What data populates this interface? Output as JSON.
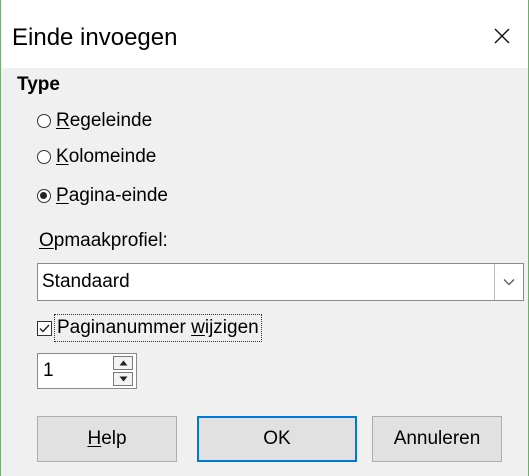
{
  "window": {
    "title": "Einde invoegen"
  },
  "type_section": {
    "title": "Type",
    "options": [
      {
        "key": "R",
        "rest": "egeleinde",
        "checked": false
      },
      {
        "key": "K",
        "rest": "olomeinde",
        "checked": false
      },
      {
        "key": "P",
        "rest": "agina-einde",
        "checked": true
      }
    ]
  },
  "style": {
    "label_key": "O",
    "label_rest": "pmaakprofiel:",
    "value": "Standaard"
  },
  "page_number": {
    "checked": true,
    "label_pre": "Paginanummer ",
    "label_key": "w",
    "label_post": "ijzigen",
    "value": "1"
  },
  "buttons": {
    "help_key": "H",
    "help_rest": "elp",
    "ok": "OK",
    "cancel": "Annuleren"
  }
}
